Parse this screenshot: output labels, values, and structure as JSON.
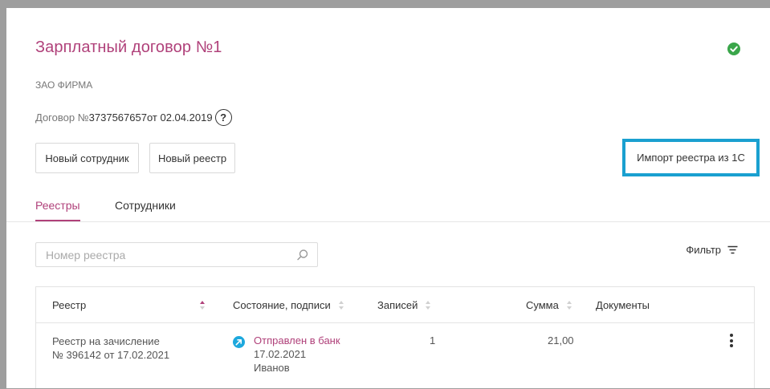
{
  "header": {
    "title": "Зарплатный договор №1",
    "company": "ЗАО ФИРМА",
    "contract_prefix": "Договор № ",
    "contract_number": "3737567657",
    "contract_date": " от 02.04.2019",
    "help": "?"
  },
  "actions": {
    "new_employee": "Новый сотрудник",
    "new_registry": "Новый реестр",
    "import_1c": "Импорт реестра из 1С"
  },
  "tabs": [
    {
      "label": "Реестры",
      "active": true
    },
    {
      "label": "Сотрудники",
      "active": false
    }
  ],
  "search": {
    "placeholder": "Номер реестра"
  },
  "filter": {
    "label": "Фильтр"
  },
  "table": {
    "columns": [
      "Реестр",
      "Состояние, подписи",
      "Записей",
      "Сумма",
      "Документы"
    ],
    "rows": [
      {
        "registry_line1": "Реестр на зачисление",
        "registry_line2": "№ 396142 от 17.02.2021",
        "state": "Отправлен в банк",
        "state_date": "17.02.2021",
        "signer": "Иванов",
        "records": "1",
        "amount": "21,00"
      }
    ]
  },
  "colors": {
    "accent": "#b0417a",
    "highlight": "#1aa0d0",
    "ok": "#3aa64a",
    "status_sent": "#1da8dd"
  },
  "icons": [
    "check-circle-icon",
    "help-icon",
    "search-icon",
    "filter-icon",
    "sort-icon",
    "arrow-sent-icon",
    "more-vertical-icon"
  ]
}
